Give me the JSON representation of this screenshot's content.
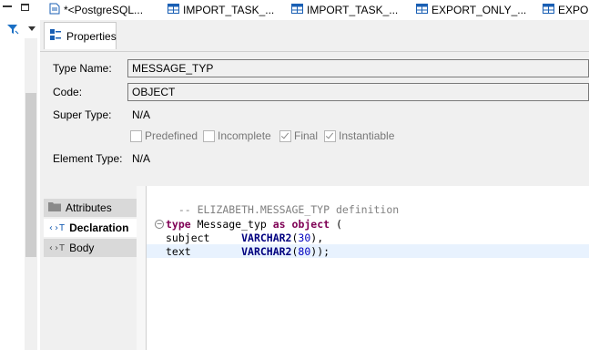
{
  "left_toolbar": {
    "icons": [
      "minimize-icon",
      "maximize-icon",
      "filter-icon",
      "dropdown-icon"
    ]
  },
  "tabs": [
    {
      "label": "*<PostgreSQL...",
      "icon": "file-icon"
    },
    {
      "label": "IMPORT_TASK_...",
      "icon": "table-icon"
    },
    {
      "label": "IMPORT_TASK_...",
      "icon": "table-icon"
    },
    {
      "label": "EXPORT_ONLY_...",
      "icon": "table-icon"
    },
    {
      "label": "EXPOR",
      "icon": "table-icon"
    }
  ],
  "subtab": {
    "label": "Properties",
    "icon": "properties-icon"
  },
  "properties": {
    "type_name_label": "Type Name:",
    "type_name_value": "MESSAGE_TYP",
    "code_label": "Code:",
    "code_value": "OBJECT",
    "super_type_label": "Super Type:",
    "super_type_value": "N/A",
    "element_type_label": "Element Type:",
    "element_type_value": "N/A",
    "flags": [
      {
        "label": "Predefined",
        "checked": false
      },
      {
        "label": "Incomplete",
        "checked": false
      },
      {
        "label": "Final",
        "checked": true
      },
      {
        "label": "Instantiable",
        "checked": true
      }
    ]
  },
  "sections": [
    {
      "label": "Attributes",
      "icon": "folder-icon"
    },
    {
      "label": "Declaration",
      "icon": "declaration-icon",
      "active": true
    },
    {
      "label": "Body",
      "icon": "body-icon"
    }
  ],
  "editor": {
    "comment": "-- ELIZABETH.MESSAGE_TYP definition",
    "line1_kw1": "type",
    "line1_name": " Message_typ ",
    "line1_kw2": "as",
    "line1_kw3": "object",
    "line1_paren": " (",
    "line2_field": "subject     ",
    "line2_type": "VARCHAR2",
    "line2_open": "(",
    "line2_num": "30",
    "line2_close": "),",
    "line3_field": "text        ",
    "line3_type": "VARCHAR2",
    "line3_open": "(",
    "line3_num": "80",
    "line3_close": "));"
  },
  "colors": {
    "keyword": "#7f0055",
    "datatype": "#00007f",
    "number": "#0000c0",
    "comment": "#808080",
    "accent": "#1a5fb4"
  }
}
